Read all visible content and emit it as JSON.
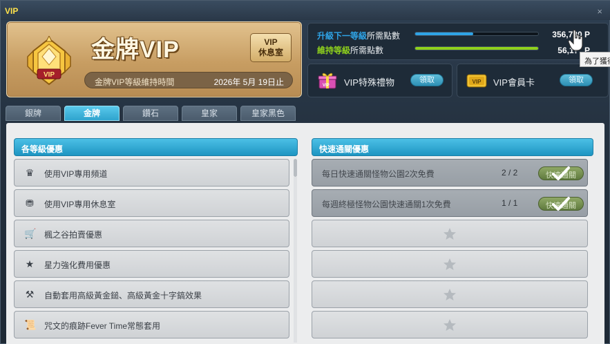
{
  "window": {
    "title": "VIP",
    "close_icon": "close-icon"
  },
  "vip_card": {
    "tier_name": "金牌VIP",
    "medal_text": "VIP",
    "lounge_button_line1": "VIP",
    "lounge_button_line2": "休息室",
    "keep_period_label": "金牌VIP等級維持時間",
    "keep_period_date": "2026年 5月 19日止"
  },
  "points": {
    "next_level": {
      "label_highlight": "升級下一等級",
      "label_rest": "所需點數",
      "value": "356,730 P",
      "progress": 0.47,
      "color": "#2fa4e7"
    },
    "maintain": {
      "label_highlight": "維持等級",
      "label_rest": "所需點數",
      "value": "56,1？ P",
      "progress": 1.0,
      "color": "#8fd11c"
    }
  },
  "gift_box": {
    "label": "VIP特殊禮物",
    "button": "領取"
  },
  "member_card": {
    "label": "VIP會員卡",
    "button": "領取",
    "card_text": "VIP"
  },
  "tooltip": {
    "text": "為了獲得"
  },
  "tabs": [
    {
      "label": "銀牌",
      "active": false
    },
    {
      "label": "金牌",
      "active": true
    },
    {
      "label": "鑽石",
      "active": false
    },
    {
      "label": "皇家",
      "active": false
    },
    {
      "label": "皇家黑色",
      "active": false
    }
  ],
  "benefits": {
    "header": "各等級優惠",
    "items": [
      {
        "icon": "crown-icon",
        "glyph": "♛",
        "label": "使用VIP專用頻道"
      },
      {
        "icon": "chair-icon",
        "glyph": "⛃",
        "label": "使用VIP專用休息室"
      },
      {
        "icon": "cart-icon",
        "glyph": "🛒",
        "label": "楓之谷拍賣優惠"
      },
      {
        "icon": "star-icon",
        "glyph": "★",
        "label": "星力強化費用優惠"
      },
      {
        "icon": "hammer-icon",
        "glyph": "⚒",
        "label": "自動套用高級黃金鎚、高級黃金十字鎬效果"
      },
      {
        "icon": "scroll-icon",
        "glyph": "📜",
        "label": "咒文的痕跡Fever Time常態套用"
      }
    ]
  },
  "quick_pass": {
    "header": "快速通關優惠",
    "items": [
      {
        "label": "每日快速通關怪物公園2次免費",
        "count": "2 / 2",
        "button": "快速通關",
        "done": true
      },
      {
        "label": "每週終極怪物公園快速通關1次免費",
        "count": "1 / 1",
        "button": "快速通關",
        "done": true
      },
      {
        "label": "",
        "empty": true
      },
      {
        "label": "",
        "empty": true
      },
      {
        "label": "",
        "empty": true
      },
      {
        "label": "",
        "empty": true
      }
    ]
  }
}
